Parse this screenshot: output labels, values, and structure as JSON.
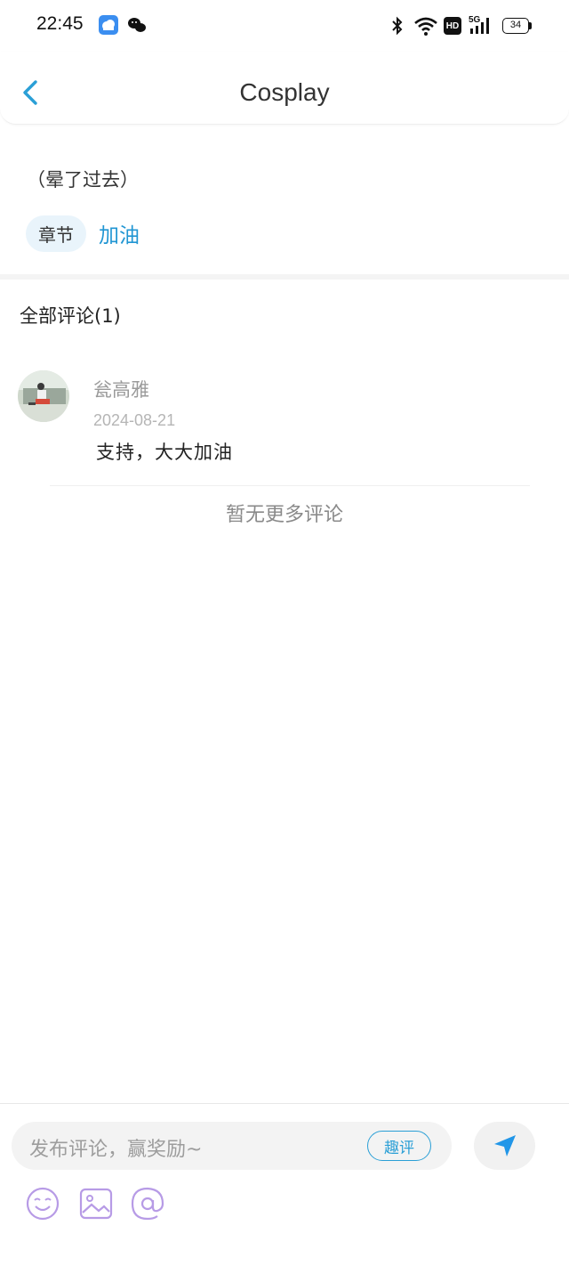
{
  "status_bar": {
    "time": "22:45",
    "left_icons": [
      "weather-app-icon",
      "wechat-icon"
    ],
    "right_icons": [
      "bluetooth-icon",
      "wifi-icon",
      "hd-icon",
      "5g-signal-icon",
      "battery-icon"
    ],
    "network_label": "5G",
    "hd_label": "HD",
    "battery_level": "34"
  },
  "header": {
    "title": "Cosplay",
    "back_icon": "chevron-left-icon"
  },
  "chapter": {
    "text": "（晕了过去）",
    "tag_label": "章节",
    "tag_link": "加油"
  },
  "comments": {
    "header": "全部评论(1)",
    "items": [
      {
        "author": "瓮高雅",
        "date": "2024-08-21",
        "text": "支持，大大加油"
      }
    ],
    "no_more": "暂无更多评论"
  },
  "composer": {
    "placeholder": "发布评论，赢奖励~",
    "quping_label": "趣评",
    "send_icon": "send-icon",
    "tools": [
      "emoji-icon",
      "image-icon",
      "mention-icon"
    ]
  },
  "colors": {
    "accent": "#2196d3",
    "tag_bg": "#e9f4fb",
    "tool_icon": "#b79be6"
  }
}
